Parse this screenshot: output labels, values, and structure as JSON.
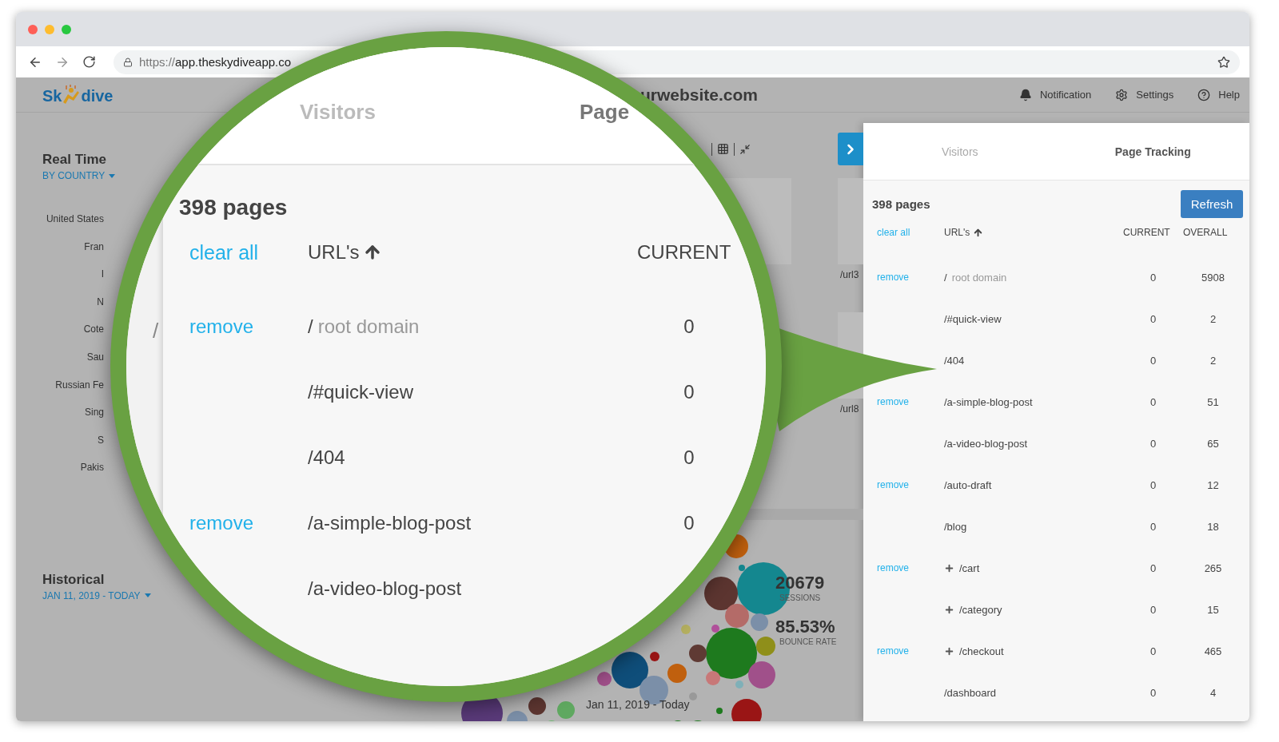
{
  "browser": {
    "url": {
      "scheme": "https://",
      "host": "app.theskydiveapp.co"
    }
  },
  "app_header": {
    "logo": {
      "left": "Sk",
      "right": "dive"
    },
    "site": "urwebsite.com",
    "nav": [
      {
        "kind": "notification",
        "label": "Notification"
      },
      {
        "kind": "settings",
        "label": "Settings"
      },
      {
        "kind": "help",
        "label": "Help"
      }
    ]
  },
  "sidebar": {
    "realtime": {
      "title": "Real Time",
      "filter": "BY COUNTRY"
    },
    "countries": [
      "United States",
      "Fran",
      "I",
      "N",
      "Cote",
      "Sau",
      "Russian Fe",
      "Sing",
      "S",
      "Pakis"
    ],
    "historical": {
      "title": "Historical",
      "range": "JAN 11, 2019 - TODAY"
    }
  },
  "main": {
    "url_cards": [
      "/url3",
      "/url8"
    ],
    "stats": [
      {
        "value": "20679",
        "label": "SESSIONS"
      },
      {
        "value": "85.53%",
        "label": "BOUNCE RATE"
      }
    ],
    "chart_range": "Jan 11, 2019 - Today"
  },
  "panel": {
    "tabs": [
      {
        "label": "Visitors",
        "selected": false
      },
      {
        "label": "Page Tracking",
        "selected": true
      }
    ],
    "count": "398 pages",
    "refresh": "Refresh",
    "clear": "clear all",
    "columns": [
      "URL's",
      "CURRENT",
      "OVERALL"
    ],
    "rows": [
      {
        "kind": "root",
        "path": "/",
        "note": "root domain",
        "remove": "remove",
        "expandable": false,
        "current": "0",
        "overall": "5908"
      },
      {
        "kind": "page",
        "path": "/#quick-view",
        "expandable": false,
        "current": "0",
        "overall": "2"
      },
      {
        "kind": "page",
        "path": "/404",
        "expandable": false,
        "current": "0",
        "overall": "2"
      },
      {
        "kind": "page",
        "path": "/a-simple-blog-post",
        "remove": "remove",
        "expandable": false,
        "current": "0",
        "overall": "51"
      },
      {
        "kind": "page",
        "path": "/a-video-blog-post",
        "expandable": false,
        "current": "0",
        "overall": "65"
      },
      {
        "kind": "page",
        "path": "/auto-draft",
        "remove": "remove",
        "expandable": false,
        "current": "0",
        "overall": "12"
      },
      {
        "kind": "page",
        "path": "/blog",
        "expandable": false,
        "current": "0",
        "overall": "18"
      },
      {
        "kind": "page",
        "path": "/cart",
        "remove": "remove",
        "expandable": true,
        "current": "0",
        "overall": "265"
      },
      {
        "kind": "page",
        "path": "/category",
        "expandable": true,
        "current": "0",
        "overall": "15"
      },
      {
        "kind": "page",
        "path": "/checkout",
        "remove": "remove",
        "expandable": true,
        "current": "0",
        "overall": "465"
      },
      {
        "kind": "page",
        "path": "/dashboard",
        "expandable": false,
        "current": "0",
        "overall": "4"
      }
    ]
  },
  "magnifier": {
    "edge_text": "/",
    "tabs": [
      {
        "label": "Visitors",
        "selected": false
      },
      {
        "label": "Page",
        "selected": true
      }
    ],
    "count": "398 pages",
    "clear": "clear all",
    "columns": [
      "URL's",
      "CURRENT"
    ],
    "rows": [
      {
        "kind": "root",
        "path": "/",
        "note": "root domain",
        "remove": "remove",
        "current": "0"
      },
      {
        "kind": "page",
        "path": "/#quick-view",
        "current": "0"
      },
      {
        "kind": "page",
        "path": "/404",
        "current": "0"
      },
      {
        "kind": "page",
        "path": "/a-simple-blog-post",
        "remove": "remove",
        "current": "0"
      },
      {
        "kind": "page",
        "path": "/a-video-blog-post"
      }
    ]
  }
}
